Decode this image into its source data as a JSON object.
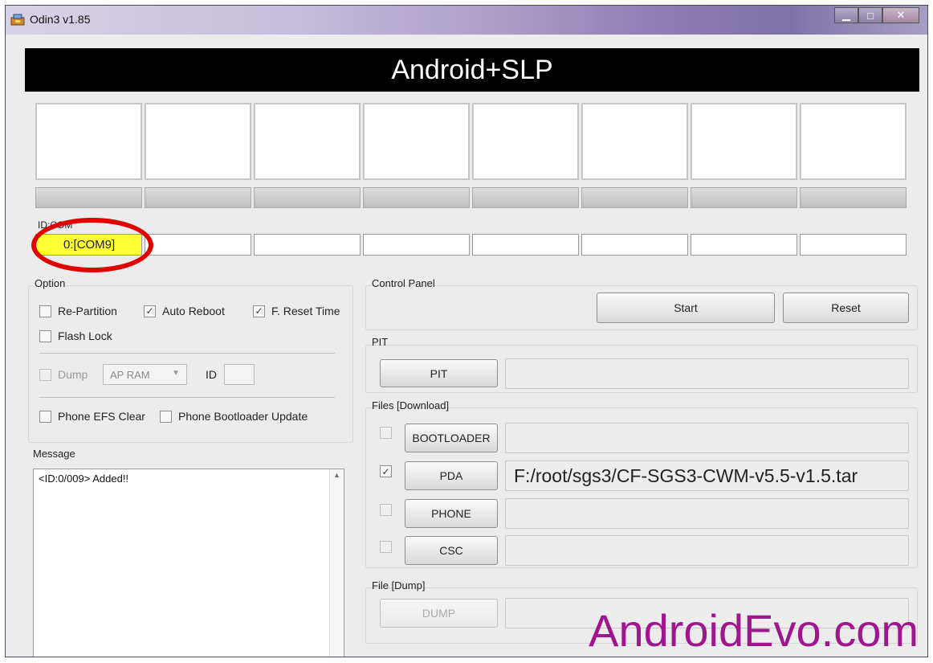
{
  "window": {
    "title": "Odin3 v1.85",
    "controls": {
      "minimize": "▁",
      "maximize": "□",
      "close": "✕"
    }
  },
  "mode_banner": "Android+SLP",
  "id_com": {
    "label": "ID:COM",
    "slots": [
      "0:[COM9]",
      "",
      "",
      "",
      "",
      "",
      "",
      ""
    ]
  },
  "option": {
    "title": "Option",
    "checkboxes": [
      {
        "label": "Re-Partition",
        "checked": false
      },
      {
        "label": "Auto Reboot",
        "checked": true
      },
      {
        "label": "F. Reset Time",
        "checked": true
      },
      {
        "label": "Flash Lock",
        "checked": false
      }
    ],
    "dump": {
      "label": "Dump",
      "checked": false,
      "select_value": "AP RAM",
      "id_label": "ID"
    },
    "phone_efs_clear": {
      "label": "Phone EFS Clear",
      "checked": false
    },
    "bootloader_update": {
      "label": "Phone Bootloader Update",
      "checked": false
    }
  },
  "message": {
    "title": "Message",
    "log": "<ID:0/009> Added!!"
  },
  "control_panel": {
    "title": "Control Panel",
    "start_label": "Start",
    "reset_label": "Reset"
  },
  "pit": {
    "title": "PIT",
    "button_label": "PIT",
    "path": ""
  },
  "files_download": {
    "title": "Files [Download]",
    "rows": [
      {
        "label": "BOOTLOADER",
        "checked": false,
        "path": ""
      },
      {
        "label": "PDA",
        "checked": true,
        "path": "F:/root/sgs3/CF-SGS3-CWM-v5.5-v1.5.tar"
      },
      {
        "label": "PHONE",
        "checked": false,
        "path": ""
      },
      {
        "label": "CSC",
        "checked": false,
        "path": ""
      }
    ]
  },
  "file_dump": {
    "title": "File [Dump]",
    "button_label": "DUMP",
    "path": ""
  },
  "watermark": "AndroidEvo.com",
  "icons": {
    "app": "odin-app-icon",
    "check": "✓",
    "scroll_up": "▲",
    "scroll_down": "▼",
    "dropdown": "▼"
  },
  "colors": {
    "active_port": "#ffff33",
    "highlight_ring": "#e00000",
    "watermark": "#a0168f",
    "banner": "#000000"
  }
}
